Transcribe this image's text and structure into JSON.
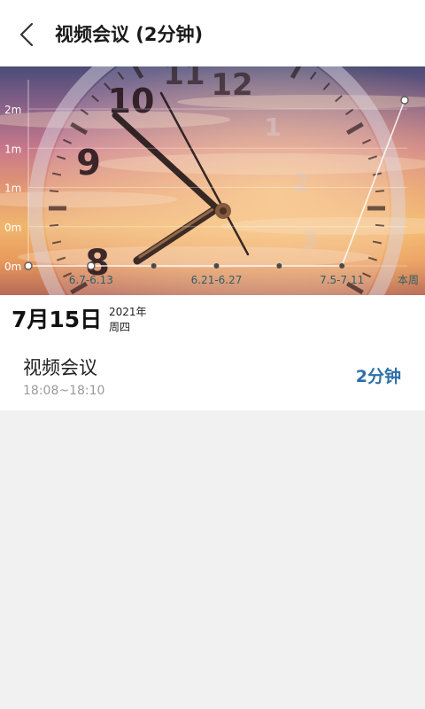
{
  "header": {
    "title": "视频会议 (2分钟)",
    "back_icon": "chevron-left-icon"
  },
  "chart_data": {
    "type": "line",
    "categories": [
      "",
      "6.7-6.13",
      "",
      "6.21-6.27",
      "",
      "7.5-7.11",
      "本周"
    ],
    "values": [
      0,
      0,
      0,
      0,
      0,
      0,
      2
    ],
    "y_ticks": [
      "0m",
      "0m",
      "1m",
      "1m",
      "2m"
    ],
    "ylim": [
      0,
      2
    ],
    "grid": true,
    "line_color": "#ffffff",
    "label_color": "#2f5f6a"
  },
  "day": {
    "date": "7月15日",
    "year": "2021年",
    "weekday": "周四"
  },
  "record": {
    "name": "视频会议",
    "time_range": "18:08~18:10",
    "duration": "2分钟",
    "duration_color": "#2e6fa6"
  }
}
